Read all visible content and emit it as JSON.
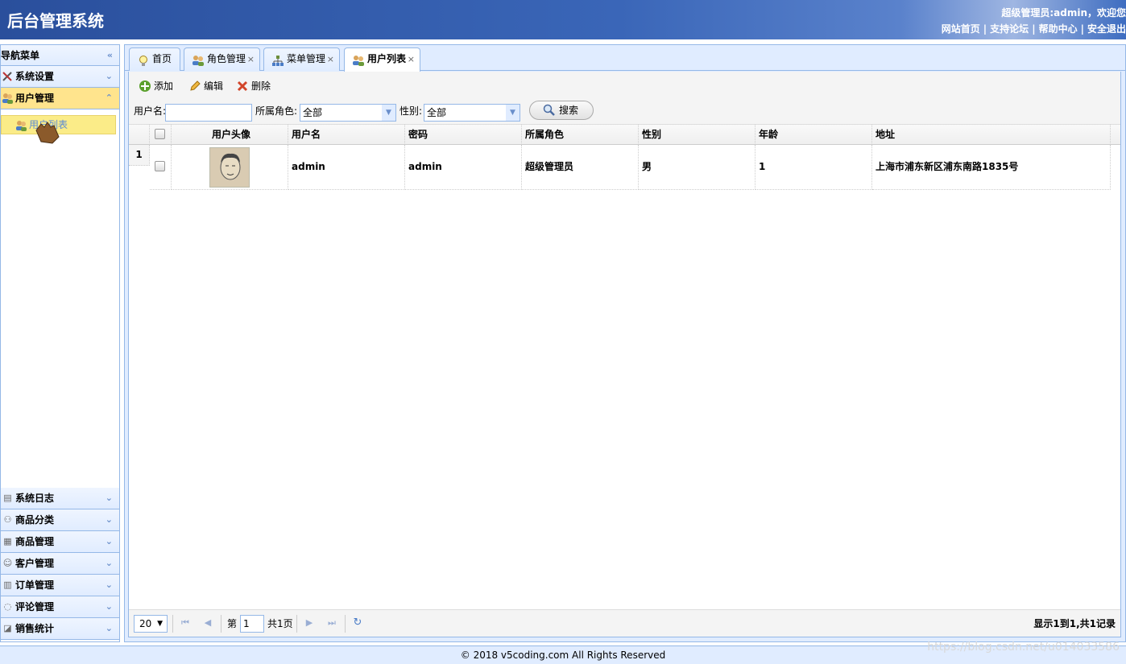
{
  "app": {
    "title": "后台管理系统",
    "welcome": "超级管理员:admin，欢迎您",
    "links": [
      "网站首页",
      "支持论坛",
      "帮助中心",
      "安全退出"
    ]
  },
  "sidebar": {
    "header": "导航菜单",
    "sections": [
      {
        "label": "系统设置",
        "icon": "tools-icon"
      },
      {
        "label": "用户管理",
        "icon": "users-icon"
      }
    ],
    "active_sub": "用户列表",
    "bottom_sections": [
      {
        "label": "系统日志",
        "icon": "log-icon"
      },
      {
        "label": "商品分类",
        "icon": "category-icon"
      },
      {
        "label": "商品管理",
        "icon": "product-icon"
      },
      {
        "label": "客户管理",
        "icon": "customer-icon"
      },
      {
        "label": "订单管理",
        "icon": "order-icon"
      },
      {
        "label": "评论管理",
        "icon": "comment-icon"
      },
      {
        "label": "销售统计",
        "icon": "chart-icon"
      }
    ]
  },
  "tabs": [
    {
      "label": "首页",
      "closable": false
    },
    {
      "label": "角色管理",
      "closable": true
    },
    {
      "label": "菜单管理",
      "closable": true
    },
    {
      "label": "用户列表",
      "closable": true,
      "selected": true
    }
  ],
  "toolbar": {
    "add": "添加",
    "edit": "编辑",
    "delete": "删除",
    "username_label": "用户名:",
    "username_value": "",
    "role_label": "所属角色:",
    "role_value": "全部",
    "gender_label": "性别:",
    "gender_value": "全部",
    "search": "搜索"
  },
  "grid": {
    "columns": [
      "用户头像",
      "用户名",
      "密码",
      "所属角色",
      "性别",
      "年龄",
      "地址"
    ],
    "rows": [
      {
        "num": "1",
        "username": "admin",
        "password": "admin",
        "role": "超级管理员",
        "gender": "男",
        "age": "1",
        "address": "上海市浦东新区浦东南路1835号"
      }
    ]
  },
  "pager": {
    "page_size": "20",
    "page_prefix": "第",
    "page_value": "1",
    "page_total": "共1页",
    "info": "显示1到1,共1记录"
  },
  "footer": "© 2018 v5coding.com All Rights Reserved",
  "watermark": "https://blog.csdn.net/u014033586",
  "colors": {
    "header": "#2a4f9c",
    "accent_border": "#95b8e7",
    "active_menu": "#ffe48d",
    "panel_bg": "#e0ecff"
  }
}
